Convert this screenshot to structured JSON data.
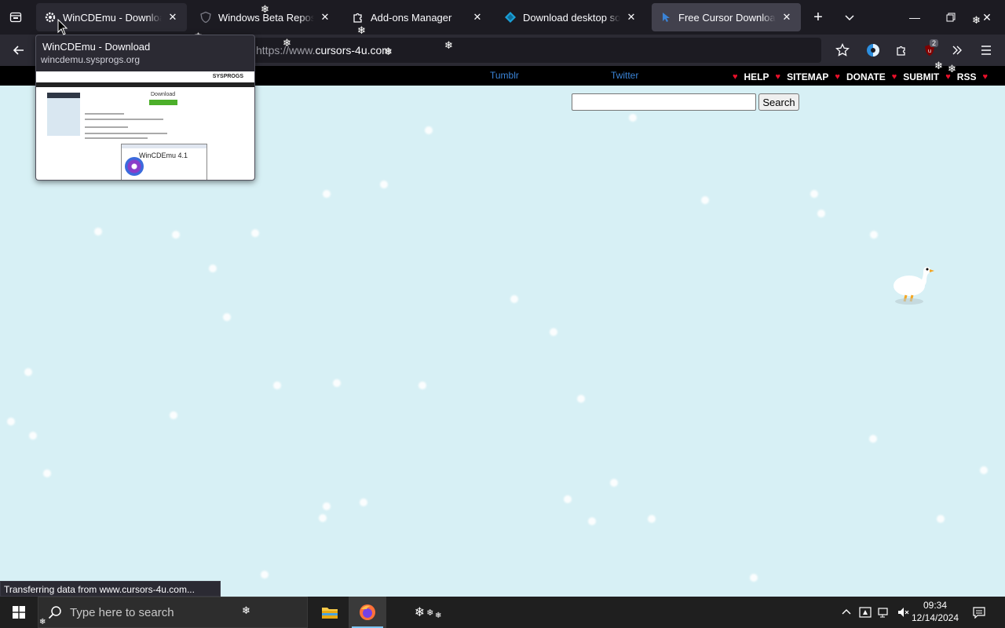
{
  "browser": {
    "tabs": [
      {
        "title": "WinCDEmu - Download",
        "state": "hover",
        "favicon": "gear-icon"
      },
      {
        "title": "Windows Beta Repository",
        "state": "normal",
        "favicon": "shield-icon"
      },
      {
        "title": "Add-ons Manager",
        "state": "normal",
        "favicon": "puzzle-icon"
      },
      {
        "title": "Download desktop software",
        "state": "normal",
        "favicon": "diamond-icon"
      },
      {
        "title": "Free Cursor Downloads - C",
        "state": "selected",
        "favicon": "cursor-icon"
      }
    ],
    "url_prefix": "https://www.",
    "url_visible": "cursors-4u.com",
    "extension_badge": "2"
  },
  "tab_preview": {
    "title": "WinCDEmu - Download",
    "url": "wincdemu.sysprogs.org",
    "thumb": {
      "logo": "SYSPROGS",
      "heading": "Download",
      "app_name": "WinCDEmu 4.1"
    }
  },
  "page": {
    "social": [
      "Tumblr",
      "Twitter"
    ],
    "menu": [
      "HELP",
      "SITEMAP",
      "DONATE",
      "SUBMIT",
      "RSS"
    ],
    "search_button": "Search",
    "search_value": ""
  },
  "status": "Transferring data from www.cursors-4u.com...",
  "taskbar": {
    "search_placeholder": "Type here to search",
    "time": "09:34",
    "date": "12/14/2024"
  },
  "colors": {
    "page_bg": "#d7f0f5",
    "accent_heart": "#e8102a",
    "link": "#3a83d6"
  }
}
